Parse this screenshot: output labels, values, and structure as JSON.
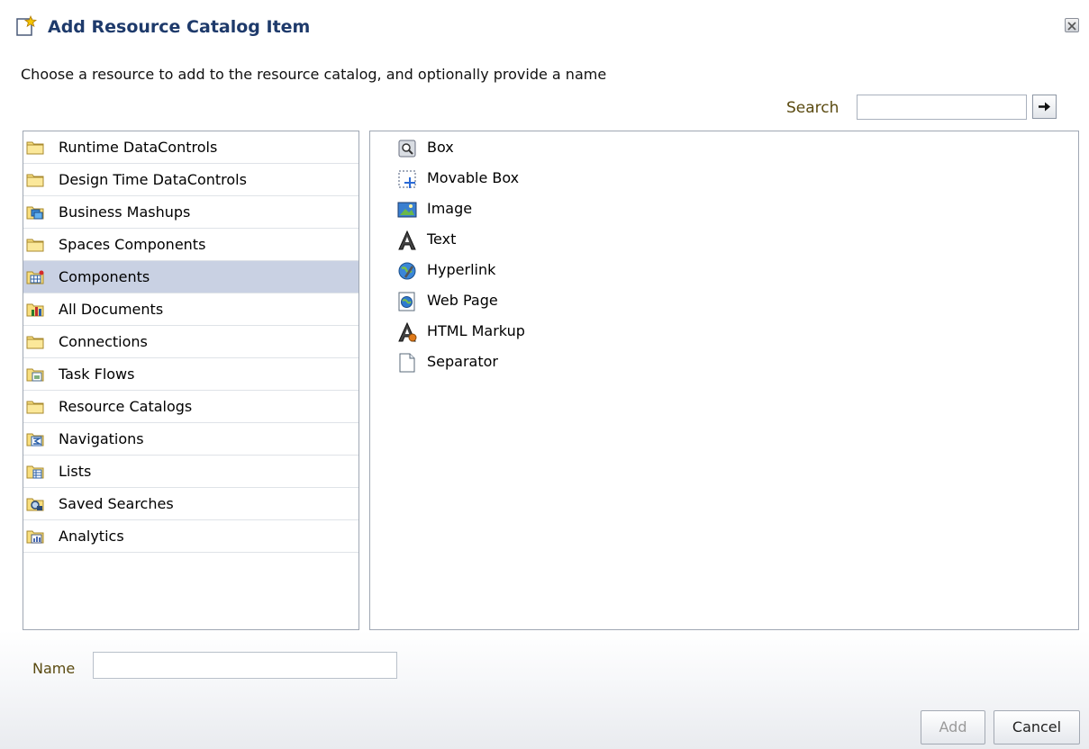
{
  "dialog": {
    "title": "Add Resource Catalog Item",
    "instruction": "Choose a resource to add to the resource catalog, and optionally provide a name"
  },
  "search": {
    "label": "Search",
    "value": ""
  },
  "categories": [
    {
      "label": "Runtime DataControls",
      "icon": "folder-icon"
    },
    {
      "label": "Design Time DataControls",
      "icon": "folder-icon"
    },
    {
      "label": "Business Mashups",
      "icon": "mashup-folder-icon"
    },
    {
      "label": "Spaces Components",
      "icon": "folder-icon"
    },
    {
      "label": "Components",
      "icon": "components-folder-icon",
      "selected": true
    },
    {
      "label": "All Documents",
      "icon": "documents-folder-icon"
    },
    {
      "label": "Connections",
      "icon": "folder-icon"
    },
    {
      "label": "Task Flows",
      "icon": "taskflow-folder-icon"
    },
    {
      "label": "Resource Catalogs",
      "icon": "folder-icon"
    },
    {
      "label": "Navigations",
      "icon": "navigation-folder-icon"
    },
    {
      "label": "Lists",
      "icon": "list-folder-icon"
    },
    {
      "label": "Saved Searches",
      "icon": "saved-search-folder-icon"
    },
    {
      "label": "Analytics",
      "icon": "analytics-folder-icon"
    }
  ],
  "components": [
    {
      "label": "Box",
      "icon": "box-icon"
    },
    {
      "label": "Movable Box",
      "icon": "movable-box-icon"
    },
    {
      "label": "Image",
      "icon": "image-icon"
    },
    {
      "label": "Text",
      "icon": "text-icon"
    },
    {
      "label": "Hyperlink",
      "icon": "hyperlink-icon"
    },
    {
      "label": "Web Page",
      "icon": "web-page-icon"
    },
    {
      "label": "HTML Markup",
      "icon": "html-markup-icon"
    },
    {
      "label": "Separator",
      "icon": "separator-icon"
    }
  ],
  "name_field": {
    "label": "Name",
    "value": ""
  },
  "buttons": {
    "add": "Add",
    "cancel": "Cancel"
  }
}
